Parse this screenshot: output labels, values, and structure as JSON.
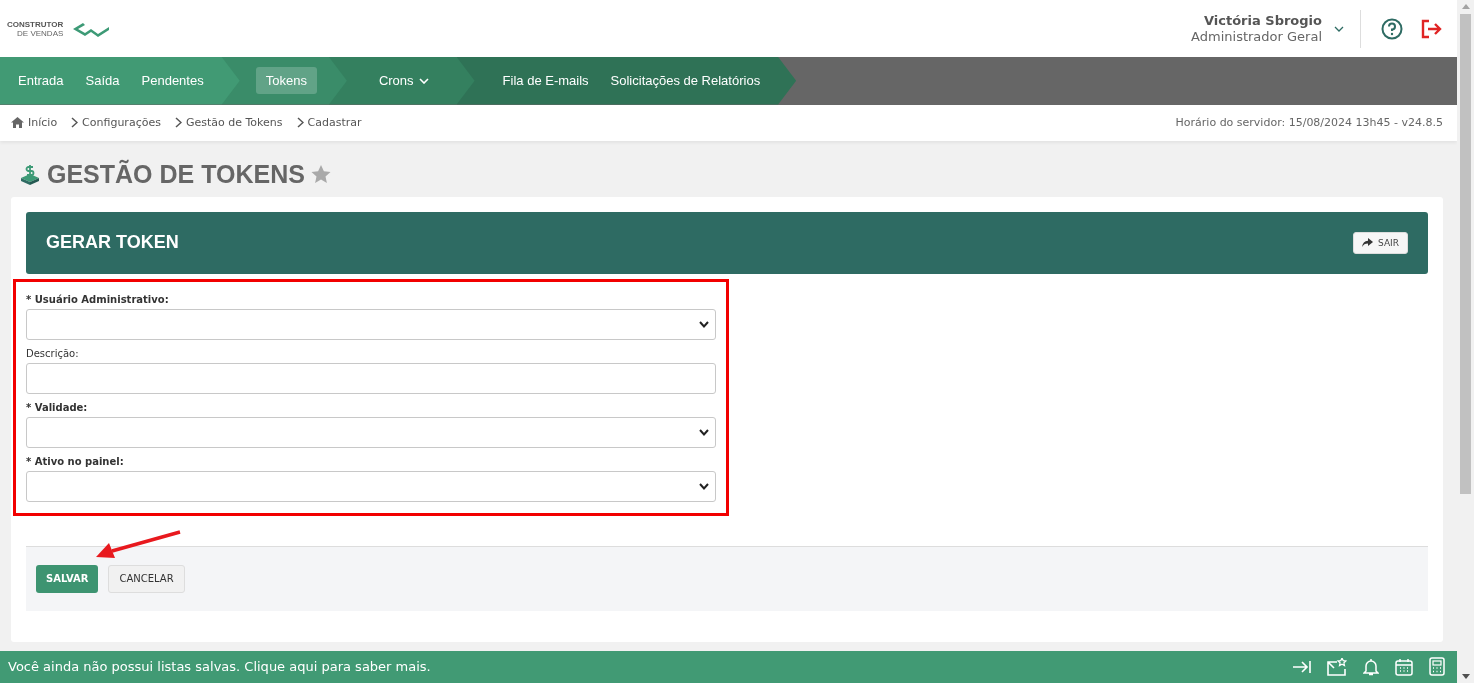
{
  "logo": {
    "line_1": "CONSTRUTOR",
    "line_2": "DE VENDAS"
  },
  "user": {
    "name": "Victória Sbrogio",
    "role": "Administrador Geral"
  },
  "nav": {
    "groups": [
      {
        "items": [
          {
            "label": "Entrada",
            "selected": false,
            "has_menu": false
          },
          {
            "label": "Saída",
            "selected": false,
            "has_menu": false
          },
          {
            "label": "Pendentes",
            "selected": false,
            "has_menu": false
          }
        ]
      },
      {
        "items": [
          {
            "label": "Tokens",
            "selected": true,
            "has_menu": false
          }
        ]
      },
      {
        "items": [
          {
            "label": "Crons",
            "selected": false,
            "has_menu": true
          }
        ]
      },
      {
        "items": [
          {
            "label": "Fila de E-mails",
            "selected": false,
            "has_menu": false
          },
          {
            "label": "Solicitações de Relatórios",
            "selected": false,
            "has_menu": false
          }
        ]
      }
    ]
  },
  "breadcrumb": [
    "Início",
    "Configurações",
    "Gestão de Tokens",
    "Cadastrar"
  ],
  "server_time": "Horário do servidor: 15/08/2024 13h45 - v24.8.5",
  "page_title": "GESTÃO DE TOKENS",
  "panel": {
    "title": "GERAR TOKEN",
    "exit_button": "SAIR"
  },
  "fields": [
    {
      "label": "* Usuário Administrativo:",
      "required": true,
      "kind": "select"
    },
    {
      "label": "Descrição:",
      "required": false,
      "kind": "text"
    },
    {
      "label": "* Validade:",
      "required": true,
      "kind": "select"
    },
    {
      "label": "* Ativo no painel:",
      "required": true,
      "kind": "select"
    }
  ],
  "buttons": [
    {
      "label": "SALVAR",
      "kind": "primary"
    },
    {
      "label": "CANCELAR",
      "kind": "secondary"
    }
  ],
  "bottom_bar": {
    "message": "Você ainda não possui listas salvas. Clique aqui para saber mais."
  }
}
